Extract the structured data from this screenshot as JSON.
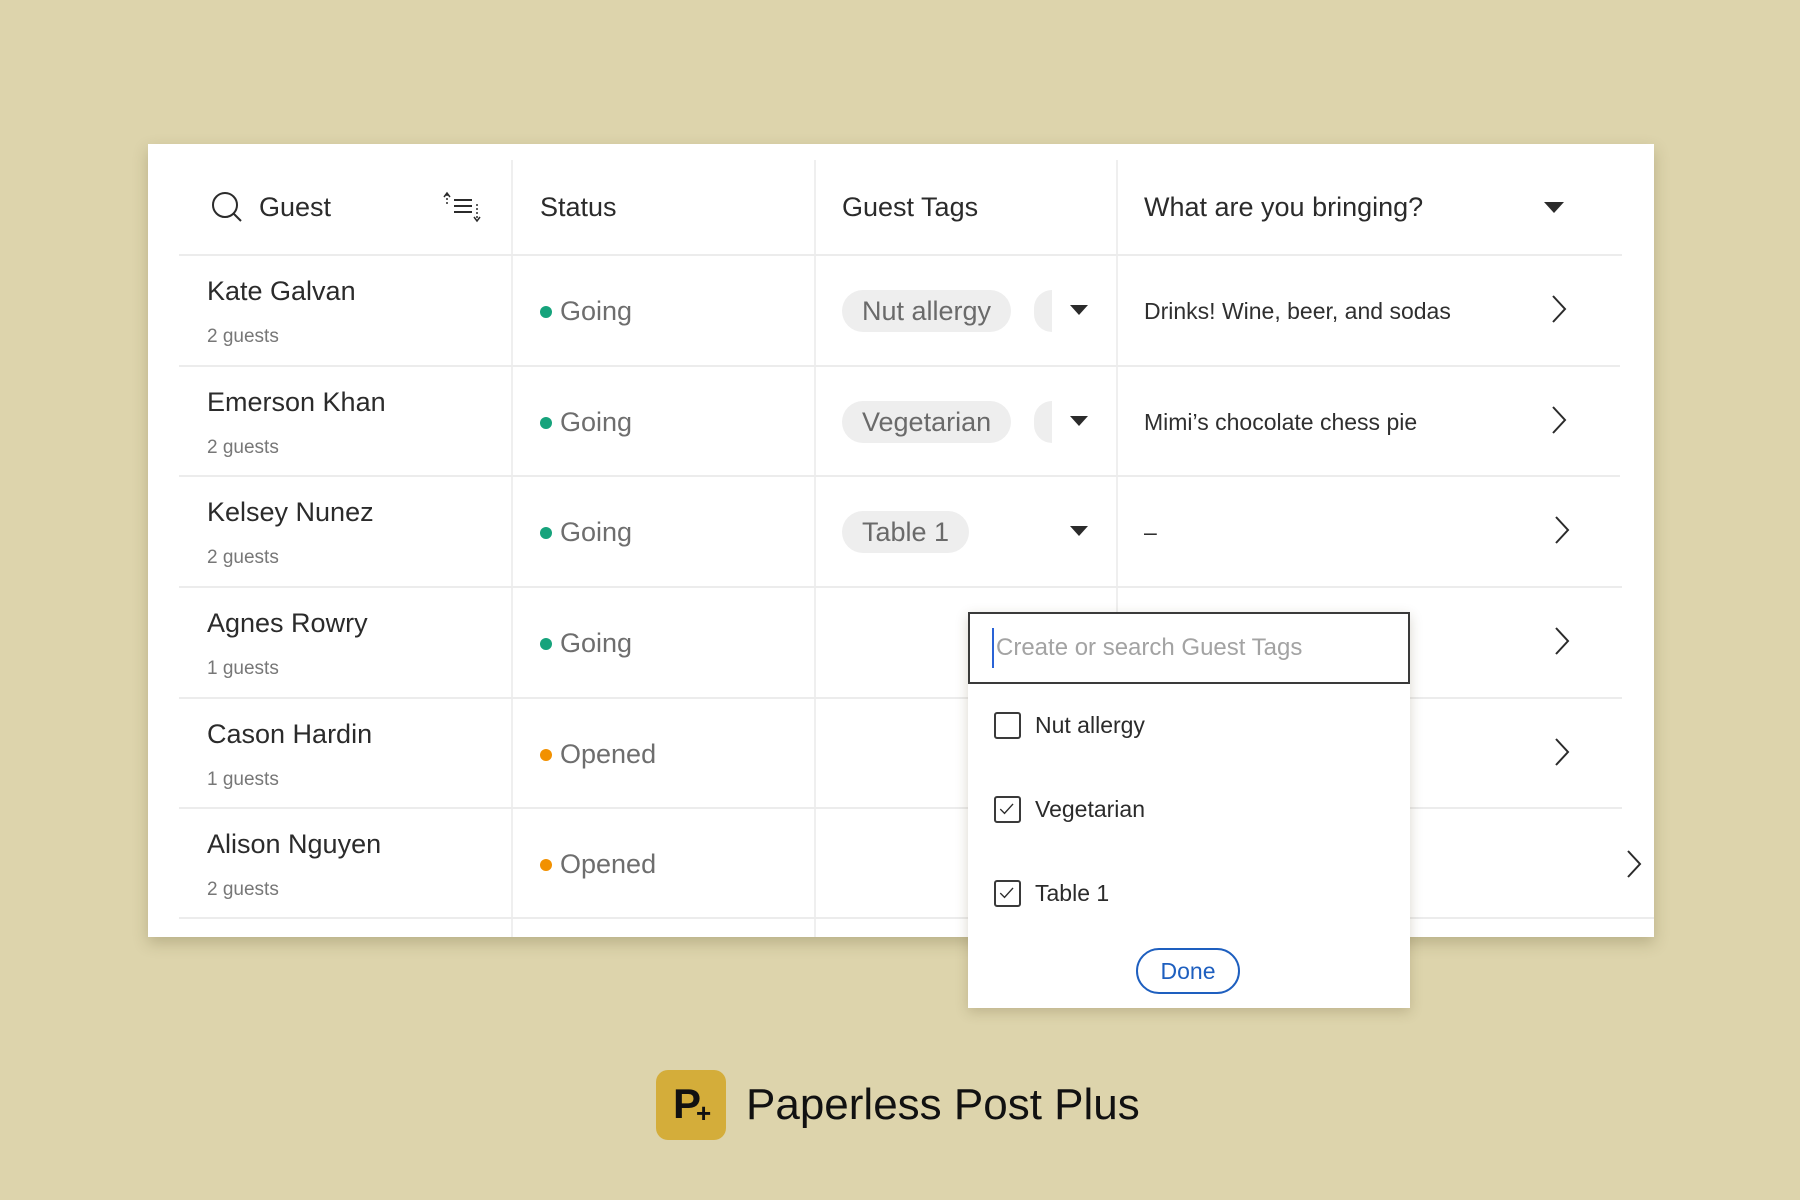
{
  "table": {
    "headers": {
      "guest": "Guest",
      "status": "Status",
      "guest_tags": "Guest Tags",
      "question": "What are you bringing?"
    },
    "icons": {
      "search": "search-icon",
      "sort": "sort-icon",
      "dropdown": "caret-down-icon",
      "row_open": "chevron-right-icon"
    },
    "rows": [
      {
        "name": "Kate Galvan",
        "guests": "2 guests",
        "status": "Going",
        "status_color": "#16a37c",
        "tags": [
          "Nut allergy"
        ],
        "more_tags": true,
        "answer": "Drinks! Wine, beer, and sodas"
      },
      {
        "name": "Emerson Khan",
        "guests": "2 guests",
        "status": "Going",
        "status_color": "#16a37c",
        "tags": [
          "Vegetarian"
        ],
        "more_tags": true,
        "answer": "Mimi’s chocolate chess pie"
      },
      {
        "name": "Kelsey Nunez",
        "guests": "2 guests",
        "status": "Going",
        "status_color": "#16a37c",
        "tags": [
          "Table 1"
        ],
        "more_tags": false,
        "answer": "–"
      },
      {
        "name": "Agnes Rowry",
        "guests": "1 guests",
        "status": "Going",
        "status_color": "#16a37c",
        "tags": [],
        "more_tags": false,
        "answer": ""
      },
      {
        "name": "Cason Hardin",
        "guests": "1 guests",
        "status": "Opened",
        "status_color": "#f29100",
        "tags": [],
        "more_tags": false,
        "answer": ""
      },
      {
        "name": "Alison Nguyen",
        "guests": "2 guests",
        "status": "Opened",
        "status_color": "#f29100",
        "tags": [],
        "more_tags": false,
        "answer": ""
      }
    ]
  },
  "tag_popup": {
    "search_value": "",
    "search_placeholder": "Create or search Guest Tags",
    "options": [
      {
        "label": "Nut allergy",
        "checked": false
      },
      {
        "label": "Vegetarian",
        "checked": true
      },
      {
        "label": "Table 1",
        "checked": true
      }
    ],
    "done_label": "Done",
    "accent_color": "#1e5fbf"
  },
  "brand": {
    "logo_letter": "P",
    "logo_plus": "+",
    "name": "Paperless Post Plus",
    "logo_color": "#d4ad3a"
  },
  "colors": {
    "background": "#ddd4ac",
    "going": "#16a37c",
    "opened": "#f29100"
  }
}
